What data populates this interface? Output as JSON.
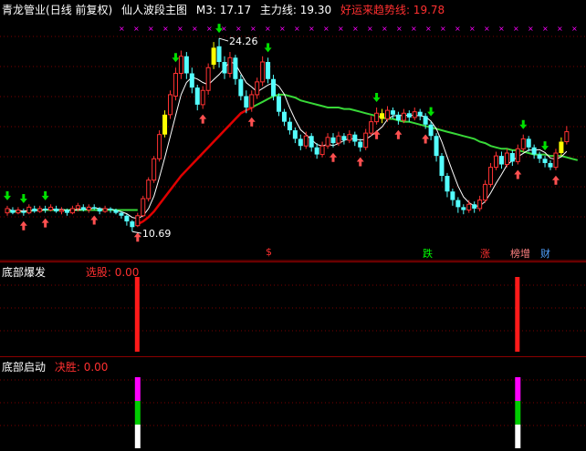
{
  "main": {
    "stock": "青龙管业",
    "period": "(日线 前复权)",
    "indicator": "仙人波段主图",
    "m3": "M3: 17.17",
    "zhuli": "主力线: 19.30",
    "haoyun": "好运来趋势线: 19.78",
    "label_high": "24.26",
    "label_low": "10.69",
    "s_mark": "$",
    "tags": [
      "跌",
      "涨",
      "榜增",
      "财"
    ]
  },
  "pane2": {
    "title": "底部爆发",
    "label": "选股: 0.00"
  },
  "pane3": {
    "title": "底部启动",
    "label": "决胜: 0.00"
  },
  "colors": {
    "up": "#ff3232",
    "down": "#54ffff",
    "green": "#38d838",
    "red_line": "#e00000",
    "white_line": "#ffffff",
    "yellow": "#ffff00",
    "magenta": "#ff00ff"
  },
  "chart_data": {
    "type": "candlestick",
    "price_range": [
      9.8,
      25.8
    ],
    "price_high": 24.26,
    "price_low": 10.69,
    "candles": [
      {
        "o": 12.0,
        "c": 12.3,
        "h": 12.5,
        "l": 11.8
      },
      {
        "o": 12.2,
        "c": 12.0,
        "h": 12.4,
        "l": 11.9
      },
      {
        "o": 12.0,
        "c": 12.2,
        "h": 12.4,
        "l": 11.9
      },
      {
        "o": 12.1,
        "c": 12.0,
        "h": 12.3,
        "l": 11.8
      },
      {
        "o": 12.0,
        "c": 12.4,
        "h": 12.6,
        "l": 11.9
      },
      {
        "o": 12.3,
        "c": 12.1,
        "h": 12.5,
        "l": 12.0
      },
      {
        "o": 12.1,
        "c": 12.3,
        "h": 12.5,
        "l": 12.0
      },
      {
        "o": 12.3,
        "c": 12.2,
        "h": 12.5,
        "l": 12.0
      },
      {
        "o": 12.2,
        "c": 12.4,
        "h": 12.6,
        "l": 12.1
      },
      {
        "o": 12.3,
        "c": 12.1,
        "h": 12.5,
        "l": 12.0
      },
      {
        "o": 12.1,
        "c": 12.2,
        "h": 12.4,
        "l": 11.9
      },
      {
        "o": 12.2,
        "c": 12.0,
        "h": 12.3,
        "l": 11.8
      },
      {
        "o": 12.0,
        "c": 12.3,
        "h": 12.5,
        "l": 11.9
      },
      {
        "o": 12.3,
        "c": 12.5,
        "h": 12.7,
        "l": 12.1
      },
      {
        "o": 12.4,
        "c": 12.2,
        "h": 12.6,
        "l": 12.1
      },
      {
        "o": 12.2,
        "c": 12.4,
        "h": 12.6,
        "l": 12.0
      },
      {
        "o": 12.4,
        "c": 12.3,
        "h": 12.6,
        "l": 12.2
      },
      {
        "o": 12.3,
        "c": 12.1,
        "h": 12.4,
        "l": 11.9
      },
      {
        "o": 12.1,
        "c": 12.3,
        "h": 12.5,
        "l": 12.0
      },
      {
        "o": 12.3,
        "c": 12.2,
        "h": 12.4,
        "l": 12.0
      },
      {
        "o": 12.2,
        "c": 12.0,
        "h": 12.3,
        "l": 11.9
      },
      {
        "o": 12.0,
        "c": 11.8,
        "h": 12.1,
        "l": 11.6
      },
      {
        "o": 11.8,
        "c": 11.4,
        "h": 11.9,
        "l": 11.1
      },
      {
        "o": 11.4,
        "c": 11.0,
        "h": 11.5,
        "l": 10.69
      },
      {
        "o": 11.1,
        "c": 11.8,
        "h": 12.0,
        "l": 11.0
      },
      {
        "o": 11.8,
        "c": 13.0,
        "h": 13.2,
        "l": 11.7
      },
      {
        "o": 13.0,
        "c": 14.3,
        "h": 14.5,
        "l": 12.8
      },
      {
        "o": 14.3,
        "c": 15.8,
        "h": 16.0,
        "l": 14.1
      },
      {
        "o": 15.8,
        "c": 17.5,
        "h": 17.8,
        "l": 15.6
      },
      {
        "o": 17.5,
        "c": 18.9,
        "h": 19.2,
        "l": 17.3
      },
      {
        "o": 18.9,
        "c": 20.3,
        "h": 20.6,
        "l": 18.6
      },
      {
        "o": 20.2,
        "c": 21.8,
        "h": 22.2,
        "l": 19.9
      },
      {
        "o": 21.8,
        "c": 23.0,
        "h": 23.4,
        "l": 21.4
      },
      {
        "o": 23.0,
        "c": 21.8,
        "h": 23.3,
        "l": 21.4
      },
      {
        "o": 21.8,
        "c": 20.8,
        "h": 22.2,
        "l": 20.4
      },
      {
        "o": 20.8,
        "c": 19.6,
        "h": 21.0,
        "l": 19.2
      },
      {
        "o": 19.6,
        "c": 20.6,
        "h": 20.9,
        "l": 19.3
      },
      {
        "o": 20.6,
        "c": 22.2,
        "h": 22.5,
        "l": 20.3
      },
      {
        "o": 22.4,
        "c": 23.6,
        "h": 24.0,
        "l": 22.1
      },
      {
        "o": 23.7,
        "c": 22.6,
        "h": 24.26,
        "l": 22.2
      },
      {
        "o": 22.6,
        "c": 21.8,
        "h": 23.0,
        "l": 21.4
      },
      {
        "o": 21.8,
        "c": 22.9,
        "h": 23.3,
        "l": 21.5
      },
      {
        "o": 22.9,
        "c": 21.4,
        "h": 23.1,
        "l": 21.0
      },
      {
        "o": 21.4,
        "c": 20.2,
        "h": 21.7,
        "l": 19.9
      },
      {
        "o": 20.2,
        "c": 19.4,
        "h": 20.6,
        "l": 19.0
      },
      {
        "o": 19.4,
        "c": 20.3,
        "h": 20.6,
        "l": 19.1
      },
      {
        "o": 20.3,
        "c": 21.2,
        "h": 21.5,
        "l": 20.0
      },
      {
        "o": 21.2,
        "c": 22.6,
        "h": 23.0,
        "l": 20.9
      },
      {
        "o": 22.6,
        "c": 21.4,
        "h": 22.9,
        "l": 21.1
      },
      {
        "o": 21.4,
        "c": 20.2,
        "h": 21.7,
        "l": 19.9
      },
      {
        "o": 20.2,
        "c": 19.1,
        "h": 20.4,
        "l": 18.8
      },
      {
        "o": 19.1,
        "c": 18.4,
        "h": 19.3,
        "l": 18.1
      },
      {
        "o": 18.4,
        "c": 17.8,
        "h": 18.7,
        "l": 17.5
      },
      {
        "o": 17.8,
        "c": 17.2,
        "h": 18.0,
        "l": 16.9
      },
      {
        "o": 17.2,
        "c": 16.7,
        "h": 17.5,
        "l": 16.4
      },
      {
        "o": 16.7,
        "c": 17.4,
        "h": 17.7,
        "l": 16.5
      },
      {
        "o": 17.4,
        "c": 16.6,
        "h": 17.6,
        "l": 16.3
      },
      {
        "o": 16.6,
        "c": 16.1,
        "h": 16.9,
        "l": 15.8
      },
      {
        "o": 16.1,
        "c": 16.7,
        "h": 17.0,
        "l": 15.9
      },
      {
        "o": 16.7,
        "c": 17.3,
        "h": 17.6,
        "l": 16.5
      },
      {
        "o": 17.3,
        "c": 16.9,
        "h": 17.6,
        "l": 16.6
      },
      {
        "o": 16.9,
        "c": 17.4,
        "h": 17.7,
        "l": 16.7
      },
      {
        "o": 17.4,
        "c": 17.1,
        "h": 17.6,
        "l": 16.8
      },
      {
        "o": 17.1,
        "c": 17.5,
        "h": 17.8,
        "l": 16.9
      },
      {
        "o": 17.5,
        "c": 17.0,
        "h": 17.7,
        "l": 16.7
      },
      {
        "o": 17.0,
        "c": 16.6,
        "h": 17.2,
        "l": 16.3
      },
      {
        "o": 16.6,
        "c": 17.6,
        "h": 17.9,
        "l": 16.4
      },
      {
        "o": 17.6,
        "c": 18.4,
        "h": 18.8,
        "l": 17.4
      },
      {
        "o": 18.4,
        "c": 19.0,
        "h": 19.4,
        "l": 18.2
      },
      {
        "o": 19.0,
        "c": 18.6,
        "h": 19.3,
        "l": 18.3
      },
      {
        "o": 18.6,
        "c": 19.2,
        "h": 19.5,
        "l": 18.4
      },
      {
        "o": 19.2,
        "c": 18.9,
        "h": 19.4,
        "l": 18.6
      },
      {
        "o": 18.9,
        "c": 18.5,
        "h": 19.1,
        "l": 18.2
      },
      {
        "o": 18.5,
        "c": 19.0,
        "h": 19.3,
        "l": 18.3
      },
      {
        "o": 19.0,
        "c": 18.7,
        "h": 19.2,
        "l": 18.4
      },
      {
        "o": 18.7,
        "c": 19.1,
        "h": 19.4,
        "l": 18.5
      },
      {
        "o": 19.1,
        "c": 18.8,
        "h": 19.3,
        "l": 18.5
      },
      {
        "o": 18.8,
        "c": 18.2,
        "h": 19.0,
        "l": 17.9
      },
      {
        "o": 18.2,
        "c": 17.4,
        "h": 18.4,
        "l": 17.1
      },
      {
        "o": 17.4,
        "c": 16.0,
        "h": 17.6,
        "l": 15.6
      },
      {
        "o": 16.0,
        "c": 14.6,
        "h": 16.2,
        "l": 14.2
      },
      {
        "o": 14.6,
        "c": 13.5,
        "h": 14.8,
        "l": 13.1
      },
      {
        "o": 13.5,
        "c": 12.9,
        "h": 13.7,
        "l": 12.5
      },
      {
        "o": 12.9,
        "c": 12.4,
        "h": 13.1,
        "l": 12.0
      },
      {
        "o": 12.4,
        "c": 12.2,
        "h": 12.6,
        "l": 11.9
      },
      {
        "o": 12.2,
        "c": 12.6,
        "h": 12.9,
        "l": 12.0
      },
      {
        "o": 12.6,
        "c": 12.3,
        "h": 12.8,
        "l": 12.0
      },
      {
        "o": 12.3,
        "c": 12.9,
        "h": 13.2,
        "l": 12.1
      },
      {
        "o": 12.9,
        "c": 14.0,
        "h": 14.3,
        "l": 12.7
      },
      {
        "o": 14.0,
        "c": 15.2,
        "h": 15.5,
        "l": 13.8
      },
      {
        "o": 15.2,
        "c": 16.0,
        "h": 16.3,
        "l": 15.0
      },
      {
        "o": 16.0,
        "c": 15.4,
        "h": 16.3,
        "l": 15.1
      },
      {
        "o": 15.4,
        "c": 16.2,
        "h": 16.5,
        "l": 15.2
      },
      {
        "o": 16.2,
        "c": 15.6,
        "h": 16.4,
        "l": 15.3
      },
      {
        "o": 15.6,
        "c": 16.5,
        "h": 16.8,
        "l": 15.4
      },
      {
        "o": 16.5,
        "c": 17.2,
        "h": 17.5,
        "l": 16.3
      },
      {
        "o": 17.2,
        "c": 16.6,
        "h": 17.4,
        "l": 16.3
      },
      {
        "o": 16.6,
        "c": 16.1,
        "h": 16.8,
        "l": 15.8
      },
      {
        "o": 16.1,
        "c": 15.8,
        "h": 16.3,
        "l": 15.5
      },
      {
        "o": 15.8,
        "c": 15.5,
        "h": 16.0,
        "l": 15.2
      },
      {
        "o": 15.5,
        "c": 15.2,
        "h": 15.7,
        "l": 15.0
      },
      {
        "o": 15.2,
        "c": 16.2,
        "h": 16.5,
        "l": 15.0
      },
      {
        "o": 16.2,
        "c": 17.0,
        "h": 17.3,
        "l": 16.0
      },
      {
        "o": 17.0,
        "c": 17.7,
        "h": 18.1,
        "l": 16.8
      }
    ],
    "yellow_candles": [
      29,
      38,
      69,
      102
    ],
    "green_line": [
      12.1,
      12.1,
      12.1,
      12.1,
      12.1,
      12.2,
      12.2,
      12.2,
      12.2,
      12.2,
      12.2,
      12.2,
      12.2,
      12.2,
      12.2,
      12.2,
      12.2,
      12.2,
      12.2,
      12.2,
      12.2,
      12.2,
      12.2,
      12.2,
      12.2
    ],
    "green_line_start": 0,
    "green_line_tail": [
      19.4,
      19.6,
      19.8,
      20.0,
      20.2,
      20.3,
      20.3,
      20.2,
      20.1,
      19.9,
      19.8,
      19.7,
      19.6,
      19.5,
      19.4,
      19.4,
      19.4,
      19.3,
      19.3,
      19.2,
      19.1,
      19.0,
      18.9,
      18.8,
      18.7,
      18.6,
      18.6,
      18.5,
      18.4,
      18.4,
      18.3,
      18.2,
      18.1,
      18.0,
      17.9,
      17.8,
      17.7,
      17.6,
      17.5,
      17.4,
      17.3,
      17.2,
      17.0,
      16.9,
      16.7,
      16.6,
      16.5,
      16.5,
      16.4,
      16.4,
      16.3,
      16.2,
      16.1,
      16.1,
      16.1,
      16.0,
      16.0,
      16.0,
      15.9,
      15.8,
      15.7
    ],
    "green_tail_start": 45,
    "red_line_start": 24,
    "red_line": [
      11.2,
      11.4,
      11.7,
      12.1,
      12.6,
      13.1,
      13.6,
      14.1,
      14.6,
      15.0,
      15.4,
      15.8,
      16.2,
      16.6,
      17.0,
      17.4,
      17.8,
      18.2,
      18.6,
      19.0,
      19.2,
      19.4
    ],
    "buy_signals": [
      3,
      7,
      16,
      24,
      36,
      45,
      60,
      65,
      68,
      72,
      77,
      94,
      101
    ],
    "sell_signals": [
      0,
      3,
      7,
      31,
      39,
      48,
      68,
      78,
      95,
      99
    ],
    "pane2_bars": [
      {
        "index": 24,
        "value": 1
      },
      {
        "index": 94,
        "value": 1
      }
    ],
    "pane3_bars": [
      {
        "index": 24,
        "segments": [
          "#ffffff",
          "#00cc00",
          "#ff00ff"
        ]
      },
      {
        "index": 94,
        "segments": [
          "#ffffff",
          "#00cc00",
          "#ff00ff"
        ]
      }
    ]
  }
}
